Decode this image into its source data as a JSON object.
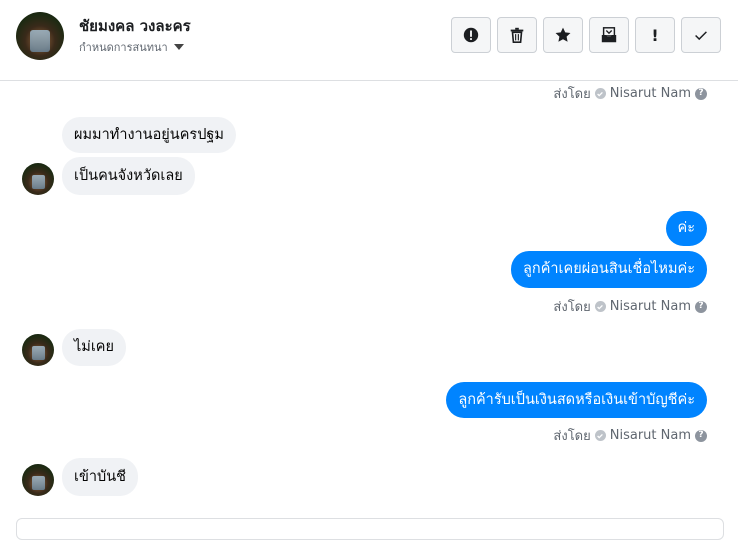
{
  "header": {
    "contact_name": "ชัยมงคล วงละคร",
    "subtitle": "กำหนดการสนทนา"
  },
  "toolbar": {
    "buttons": [
      {
        "name": "report-button",
        "icon": "alert-circle-icon"
      },
      {
        "name": "delete-button",
        "icon": "trash-icon"
      },
      {
        "name": "star-button",
        "icon": "star-icon"
      },
      {
        "name": "archive-button",
        "icon": "archive-icon"
      },
      {
        "name": "important-button",
        "icon": "exclamation-icon"
      },
      {
        "name": "done-button",
        "icon": "check-icon"
      }
    ]
  },
  "meta": {
    "sent_by_prefix": "ส่งโดย",
    "sender": "Nisarut Nam"
  },
  "messages": [
    {
      "dir": "in",
      "text": "ผมมาทำงานอยู่นครปฐม"
    },
    {
      "dir": "in",
      "text": "เป็นคนจังหวัดเลย"
    },
    {
      "dir": "out",
      "text": "ค่ะ"
    },
    {
      "dir": "out",
      "text": "ลูกค้าเคยผ่อนสินเชื่อไหมค่ะ"
    },
    {
      "dir": "in",
      "text": "ไม่เคย"
    },
    {
      "dir": "out",
      "text": "ลูกค้ารับเป็นเงินสดหรือเงินเข้าบัญชีค่ะ"
    },
    {
      "dir": "in",
      "text": "เข้าบันชี"
    }
  ],
  "colors": {
    "outgoing_bubble": "#0084ff",
    "incoming_bubble": "#f0f2f5"
  }
}
